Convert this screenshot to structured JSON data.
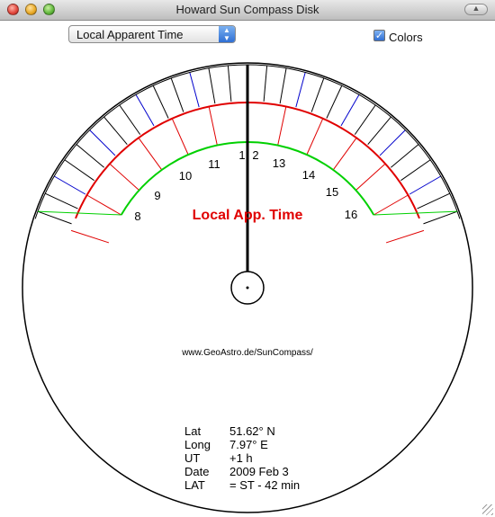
{
  "window": {
    "title": "Howard Sun Compass Disk"
  },
  "controls": {
    "mode_select": {
      "value": "Local Apparent Time"
    },
    "colors_checkbox": {
      "label": "Colors",
      "checked": true
    }
  },
  "compass": {
    "hour_labels": [
      "8",
      "9",
      "10",
      "11",
      "1",
      "2",
      "13",
      "14",
      "15",
      "16"
    ],
    "center_label": "Local App. Time",
    "website": "www.GeoAstro.de/SunCompass/",
    "info": [
      {
        "label": "Lat",
        "value": "51.62° N"
      },
      {
        "label": "Long",
        "value": "7.97° E"
      },
      {
        "label": "UT",
        "value": "+1 h"
      },
      {
        "label": "Date",
        "value": "2009 Feb 3"
      },
      {
        "label": "LAT",
        "value": "= ST - 42 min"
      }
    ]
  },
  "colors": {
    "red": "#e00000",
    "green": "#00d000",
    "blue": "#0000cc",
    "gnomon": "#000000"
  }
}
